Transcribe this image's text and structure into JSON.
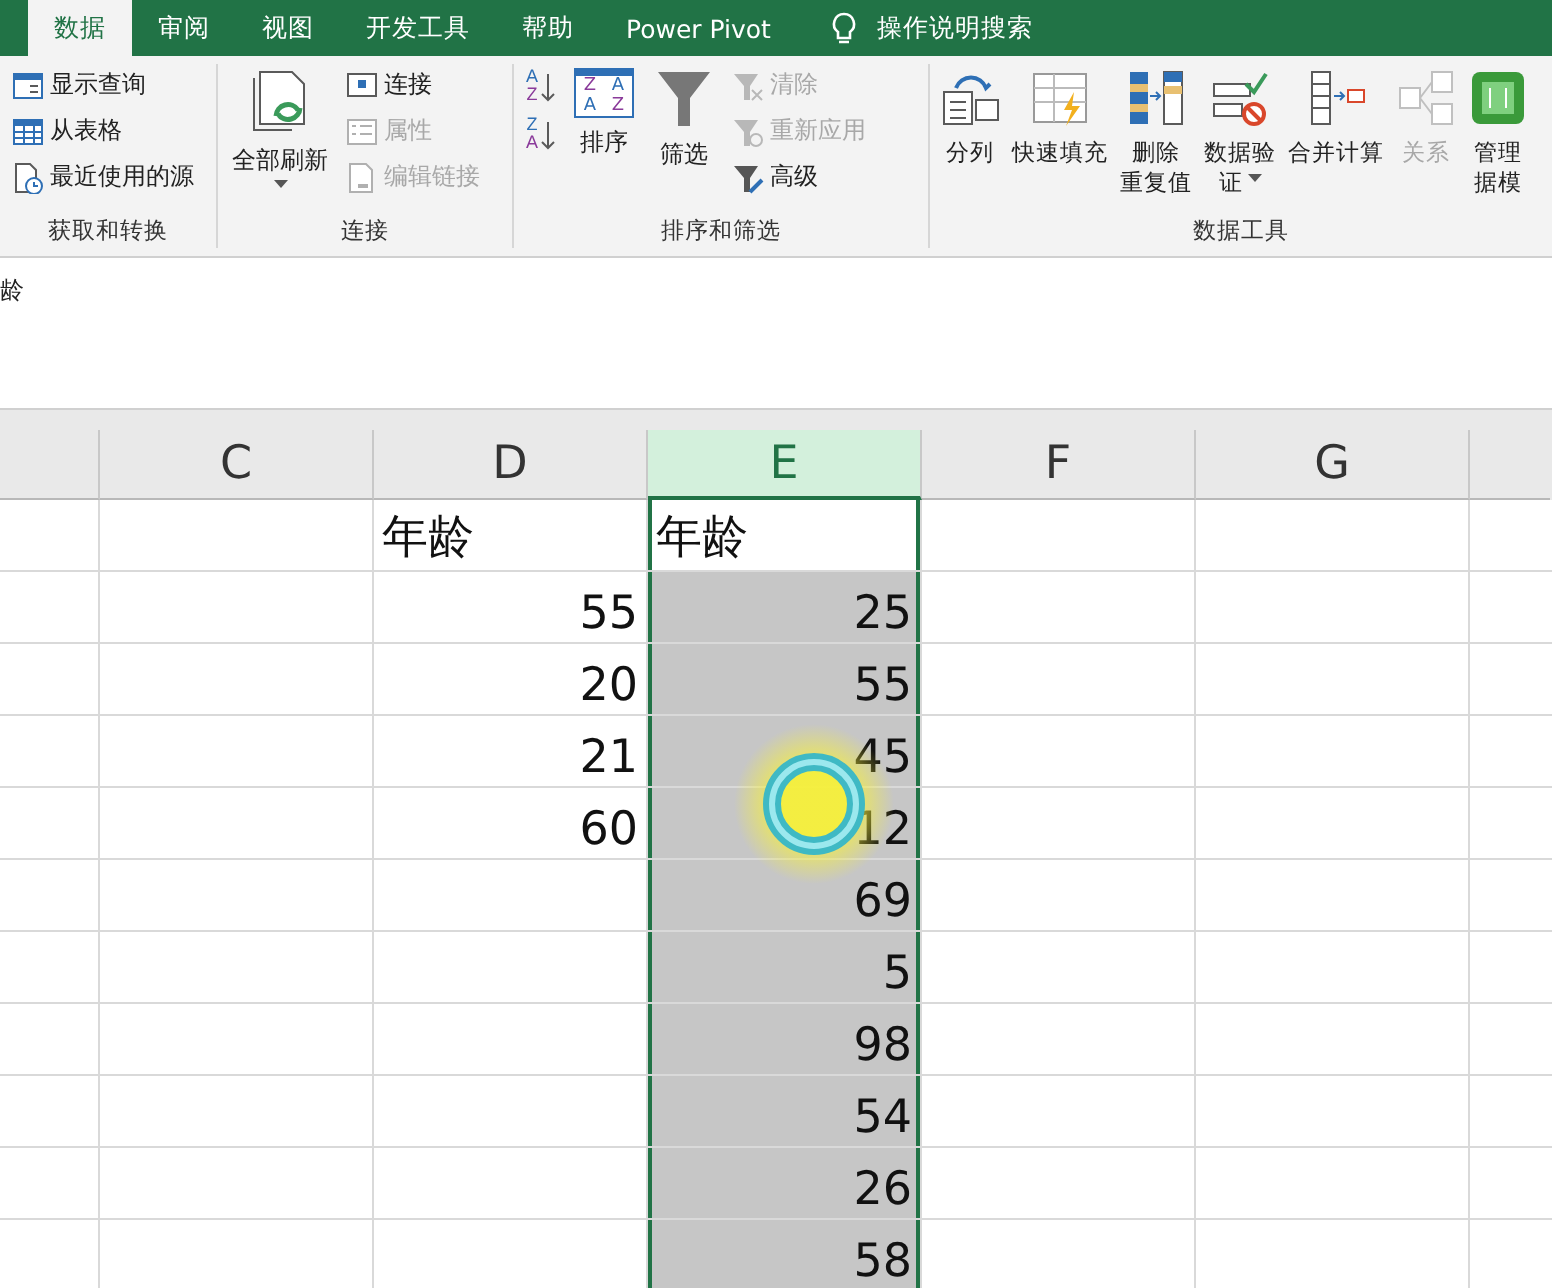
{
  "tabs": [
    {
      "label": "数据",
      "selected": true
    },
    {
      "label": "审阅",
      "selected": false
    },
    {
      "label": "视图",
      "selected": false
    },
    {
      "label": "开发工具",
      "selected": false
    },
    {
      "label": "帮助",
      "selected": false
    },
    {
      "label": "Power Pivot",
      "selected": false
    }
  ],
  "search": {
    "placeholder": "操作说明搜索"
  },
  "formula_bar": {
    "value": "龄"
  },
  "ribbon_groups": [
    {
      "label": "获取和转换",
      "columns": [
        [
          {
            "kind": "small",
            "label": "显示查询",
            "disabled": false
          },
          {
            "kind": "small",
            "label": "从表格",
            "disabled": false
          },
          {
            "kind": "small",
            "label": "最近使用的源",
            "disabled": false
          }
        ]
      ]
    },
    {
      "label": "连接",
      "columns": [
        [
          {
            "kind": "large",
            "lines": [
              "全部刷新"
            ],
            "dropdown": true,
            "disabled": false
          }
        ],
        [
          {
            "kind": "small",
            "label": "连接",
            "disabled": false
          },
          {
            "kind": "small",
            "label": "属性",
            "disabled": true
          },
          {
            "kind": "small",
            "label": "编辑链接",
            "disabled": true
          }
        ]
      ]
    },
    {
      "label": "排序和筛选",
      "columns": [
        [
          {
            "kind": "iconbtn",
            "letters": [
              "A",
              "Z"
            ],
            "disabled": false
          },
          {
            "kind": "iconbtn",
            "letters": [
              "Z",
              "A"
            ],
            "disabled": false
          }
        ],
        [
          {
            "kind": "large",
            "lines": [
              "排序"
            ],
            "letters": [
              "Z",
              "A",
              "A",
              "Z"
            ],
            "dropdown": false,
            "disabled": false
          }
        ],
        [
          {
            "kind": "large",
            "lines": [
              "筛选"
            ],
            "dropdown": false,
            "disabled": false
          }
        ],
        [
          {
            "kind": "small",
            "label": "清除",
            "disabled": true
          },
          {
            "kind": "small",
            "label": "重新应用",
            "disabled": true
          },
          {
            "kind": "small",
            "label": "高级",
            "disabled": false
          }
        ]
      ]
    },
    {
      "label": "数据工具",
      "columns": [
        [
          {
            "kind": "large",
            "lines": [
              "分列"
            ],
            "dropdown": false,
            "disabled": false
          }
        ],
        [
          {
            "kind": "large",
            "lines": [
              "快速填充"
            ],
            "dropdown": false,
            "disabled": false
          }
        ],
        [
          {
            "kind": "large",
            "lines": [
              "删除",
              "重复值"
            ],
            "dropdown": false,
            "disabled": false
          }
        ],
        [
          {
            "kind": "large",
            "lines": [
              "数据验",
              "证"
            ],
            "dropdown": true,
            "disabled": false
          }
        ],
        [
          {
            "kind": "large",
            "lines": [
              "合并计算"
            ],
            "dropdown": false,
            "disabled": false
          }
        ],
        [
          {
            "kind": "large",
            "lines": [
              "关系"
            ],
            "dropdown": false,
            "disabled": true
          }
        ],
        [
          {
            "kind": "large",
            "lines": [
              "管理",
              "据模"
            ],
            "dropdown": false,
            "disabled": false
          }
        ]
      ]
    }
  ],
  "columns": [
    {
      "label": "C",
      "selected": false
    },
    {
      "label": "D",
      "selected": false
    },
    {
      "label": "E",
      "selected": true
    },
    {
      "label": "F",
      "selected": false
    },
    {
      "label": "G",
      "selected": false
    }
  ],
  "rows": [
    {
      "d": {
        "text": "年龄",
        "kind": "text"
      },
      "e": {
        "text": "年龄",
        "kind": "text",
        "selected": false
      }
    },
    {
      "d": {
        "text": "55",
        "kind": "number"
      },
      "e": {
        "text": "25",
        "kind": "number",
        "selected": true
      }
    },
    {
      "d": {
        "text": "20",
        "kind": "number"
      },
      "e": {
        "text": "55",
        "kind": "number",
        "selected": true
      }
    },
    {
      "d": {
        "text": "21",
        "kind": "number"
      },
      "e": {
        "text": "45",
        "kind": "number",
        "selected": true
      }
    },
    {
      "d": {
        "text": "60",
        "kind": "number"
      },
      "e": {
        "text": "12",
        "kind": "number",
        "selected": true
      }
    },
    {
      "e": {
        "text": "69",
        "kind": "number",
        "selected": true
      }
    },
    {
      "e": {
        "text": "5",
        "kind": "number",
        "selected": true
      }
    },
    {
      "e": {
        "text": "98",
        "kind": "number",
        "selected": true
      }
    },
    {
      "e": {
        "text": "54",
        "kind": "number",
        "selected": true
      }
    },
    {
      "e": {
        "text": "26",
        "kind": "number",
        "selected": true
      }
    },
    {
      "e": {
        "text": "58",
        "kind": "number",
        "selected": true
      }
    }
  ]
}
